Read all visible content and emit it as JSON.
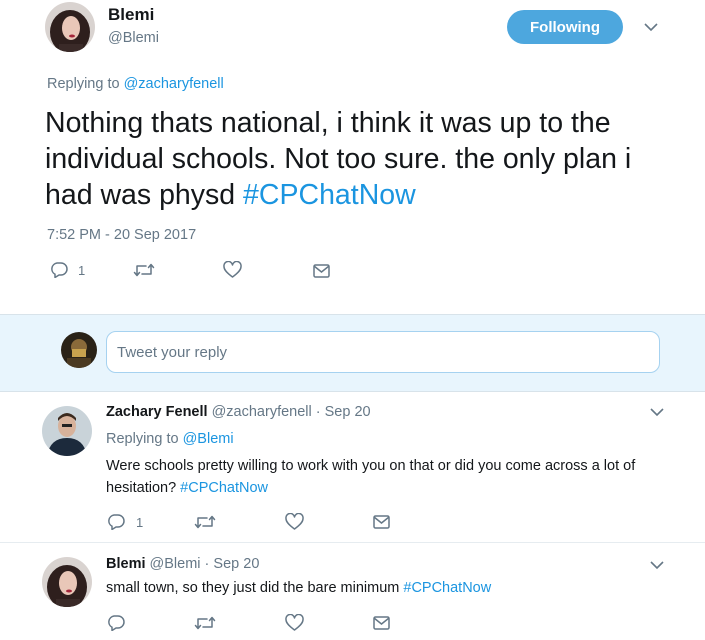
{
  "main_tweet": {
    "name": "Blemi",
    "handle": "@Blemi",
    "follow_label": "Following",
    "replying_prefix": "Replying to",
    "replying_to": "@zacharyfenell",
    "text": "Nothing thats national, i think it was up to the individual schools.  Not too sure. the only plan i had was physd ",
    "hashtag": "#CPChatNow",
    "timestamp": "7:52 PM - 20 Sep 2017",
    "reply_count": "1"
  },
  "composer": {
    "placeholder": "Tweet your reply"
  },
  "replies": [
    {
      "name": "Zachary Fenell",
      "handle": "@zacharyfenell",
      "sep": "·",
      "date": "Sep 20",
      "replying_prefix": "Replying to",
      "replying_to": "@Blemi",
      "text": "Were schools pretty willing to work with you on that or did you come across a lot of hesitation? ",
      "hashtag": "#CPChatNow",
      "reply_count": "1"
    },
    {
      "name": "Blemi",
      "handle": "@Blemi",
      "sep": "·",
      "date": "Sep 20",
      "text": "small town, so they just did the bare minimum ",
      "hashtag": "#CPChatNow"
    }
  ],
  "colors": {
    "accent": "#1b95e0",
    "follow_button": "#4da7de",
    "secondary_text": "#657786",
    "reply_area": "#e8f5fd"
  },
  "icons": [
    "reply-icon",
    "retweet-icon",
    "like-icon",
    "message-icon",
    "chevron-down-icon"
  ]
}
